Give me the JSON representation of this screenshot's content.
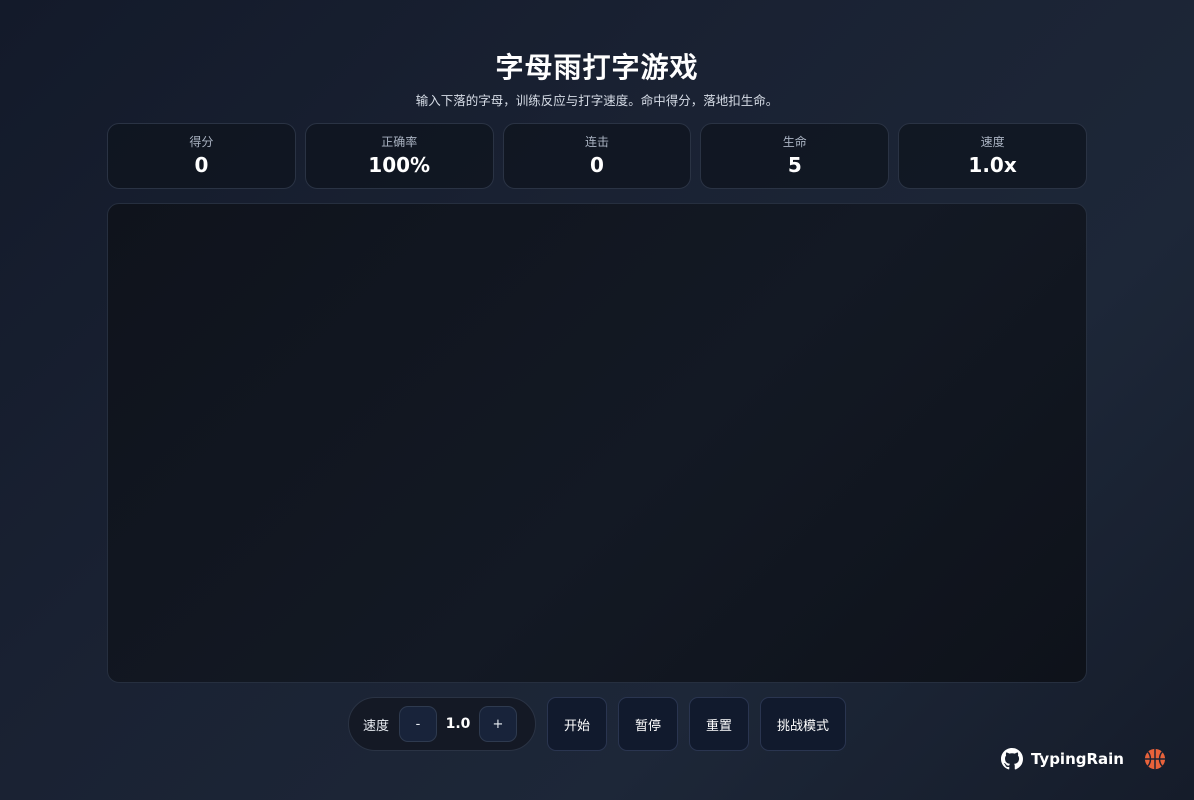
{
  "header": {
    "title": "字母雨打字游戏",
    "subtitle": "输入下落的字母，训练反应与打字速度。命中得分，落地扣生命。"
  },
  "stats": [
    {
      "label": "得分",
      "value": "0"
    },
    {
      "label": "正确率",
      "value": "100%"
    },
    {
      "label": "连击",
      "value": "0"
    },
    {
      "label": "生命",
      "value": "5"
    },
    {
      "label": "速度",
      "value": "1.0x"
    }
  ],
  "controls": {
    "speed_label": "速度",
    "decrease_label": "-",
    "speed_value": "1.0",
    "increase_label": "+",
    "start_label": "开始",
    "pause_label": "暂停",
    "reset_label": "重置",
    "challenge_label": "挑战模式"
  },
  "footer": {
    "brand": "TypingRain",
    "icons": [
      "github-icon",
      "basketball-icon"
    ]
  },
  "colors": {
    "background": "#1a2233",
    "panel": "#0e131d",
    "button": "#111a2d",
    "accent": "#e8623a"
  }
}
